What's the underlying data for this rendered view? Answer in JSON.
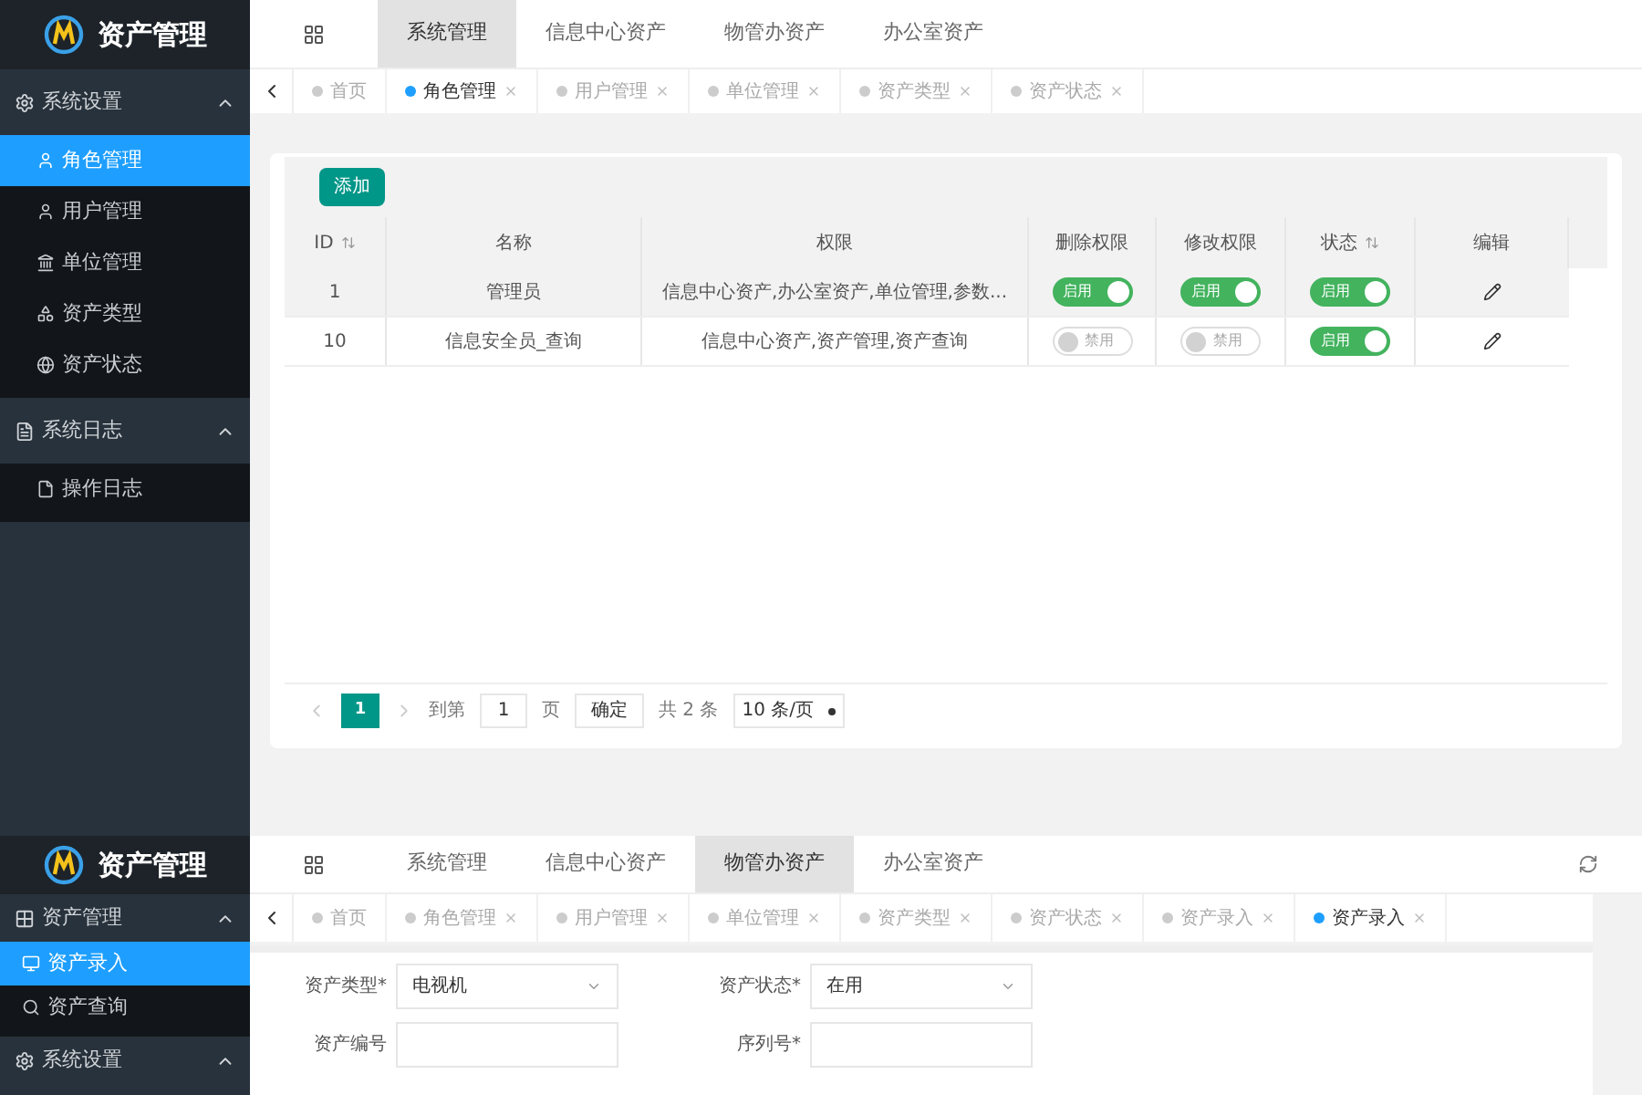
{
  "screens": [
    {
      "brand": "资产管理",
      "sidebar": [
        {
          "label": "系统设置",
          "expanded": true,
          "items": [
            {
              "label": "角色管理",
              "selected": true
            },
            {
              "label": "用户管理",
              "selected": false
            },
            {
              "label": "单位管理",
              "selected": false
            },
            {
              "label": "资产类型",
              "selected": false
            },
            {
              "label": "资产状态",
              "selected": false
            }
          ]
        },
        {
          "label": "系统日志",
          "expanded": true,
          "items": [
            {
              "label": "操作日志",
              "selected": false
            }
          ]
        }
      ],
      "top_tabs": [
        {
          "label": "系统管理",
          "selected": true
        },
        {
          "label": "信息中心资产",
          "selected": false
        },
        {
          "label": "物管办资产",
          "selected": false
        },
        {
          "label": "办公室资产",
          "selected": false
        }
      ],
      "page_tabs": [
        {
          "label": "首页",
          "selected": false,
          "closable": false
        },
        {
          "label": "角色管理",
          "selected": true,
          "closable": true
        },
        {
          "label": "用户管理",
          "selected": false,
          "closable": true
        },
        {
          "label": "单位管理",
          "selected": false,
          "closable": true
        },
        {
          "label": "资产类型",
          "selected": false,
          "closable": true
        },
        {
          "label": "资产状态",
          "selected": false,
          "closable": true
        }
      ],
      "content": {
        "kind": "table",
        "add_button": "添加",
        "columns": [
          {
            "label": "ID",
            "sortable": true
          },
          {
            "label": "名称",
            "sortable": false
          },
          {
            "label": "权限",
            "sortable": false
          },
          {
            "label": "删除权限",
            "sortable": false
          },
          {
            "label": "修改权限",
            "sortable": false
          },
          {
            "label": "状态",
            "sortable": true
          },
          {
            "label": "编辑",
            "sortable": false
          }
        ],
        "rows": [
          {
            "id": "1",
            "name": "管理员",
            "permissions": "信息中心资产,办公室资产,单位管理,参数...",
            "highlighted": true,
            "switches": [
              {
                "on": true,
                "label": "启用"
              },
              {
                "on": true,
                "label": "启用"
              },
              {
                "on": true,
                "label": "启用"
              }
            ]
          },
          {
            "id": "10",
            "name": "信息安全员_查询",
            "permissions": "信息中心资产,资产管理,资产查询",
            "highlighted": false,
            "switches": [
              {
                "on": false,
                "label": "禁用"
              },
              {
                "on": false,
                "label": "禁用"
              },
              {
                "on": true,
                "label": "启用"
              }
            ]
          }
        ],
        "pagination": {
          "current": "1",
          "goto_label": "到第",
          "goto_value": "1",
          "page_label": "页",
          "confirm": "确定",
          "total": "共 2 条",
          "page_size": "10 条/页"
        }
      }
    },
    {
      "brand": "资产管理",
      "sidebar": [
        {
          "label": "资产管理",
          "expanded": true,
          "items": [
            {
              "label": "资产录入",
              "selected": true
            },
            {
              "label": "资产查询",
              "selected": false
            }
          ]
        },
        {
          "label": "系统设置",
          "expanded": true
        }
      ],
      "top_tabs": [
        {
          "label": "系统管理",
          "selected": false
        },
        {
          "label": "信息中心资产",
          "selected": false
        },
        {
          "label": "物管办资产",
          "selected": true
        },
        {
          "label": "办公室资产",
          "selected": false
        }
      ],
      "page_tabs": [
        {
          "label": "首页",
          "selected": false,
          "closable": false
        },
        {
          "label": "角色管理",
          "selected": false,
          "closable": true
        },
        {
          "label": "用户管理",
          "selected": false,
          "closable": true
        },
        {
          "label": "单位管理",
          "selected": false,
          "closable": true
        },
        {
          "label": "资产类型",
          "selected": false,
          "closable": true
        },
        {
          "label": "资产状态",
          "selected": false,
          "closable": true
        },
        {
          "label": "资产录入",
          "selected": false,
          "closable": true
        },
        {
          "label": "资产录入",
          "selected": true,
          "closable": true
        }
      ],
      "content": {
        "kind": "form",
        "fields": [
          {
            "label": "资产类型*",
            "kind": "select",
            "value": "电视机"
          },
          {
            "label": "资产状态*",
            "kind": "select",
            "value": "在用"
          },
          {
            "label": "资产编号",
            "kind": "input"
          },
          {
            "label": "序列号*",
            "kind": "input"
          }
        ]
      }
    }
  ]
}
